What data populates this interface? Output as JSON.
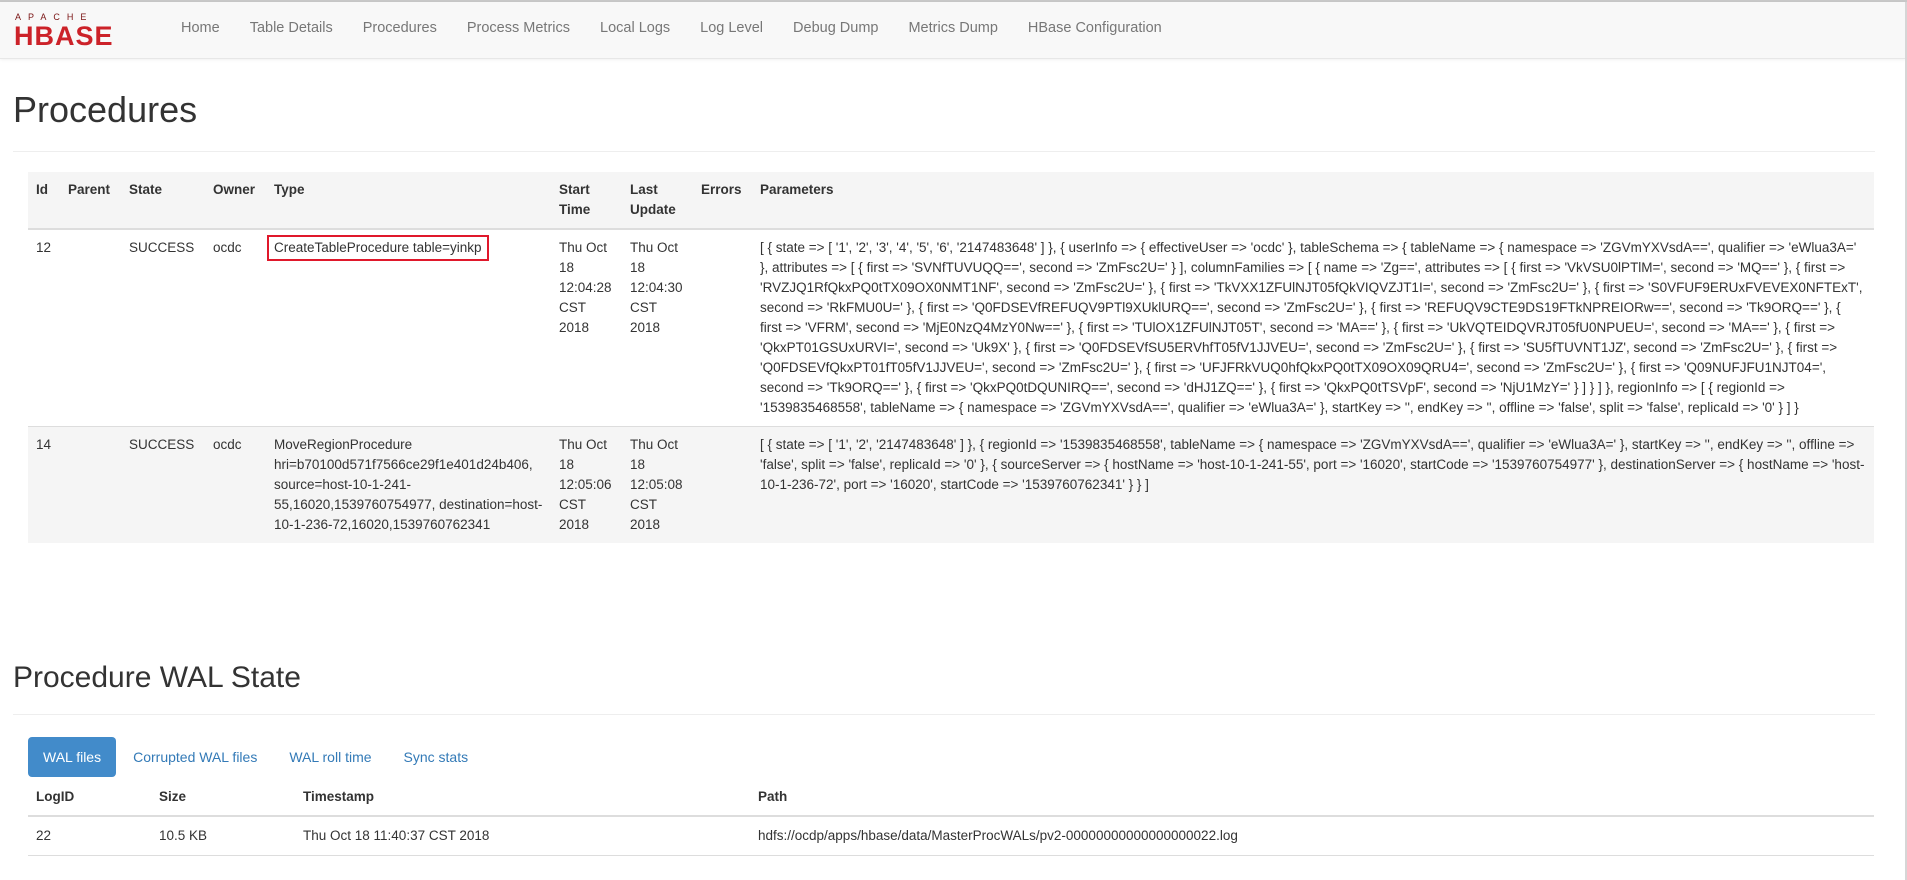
{
  "brand": {
    "top": "APACHE",
    "main": "HBASE",
    "color": "#cc2229"
  },
  "nav": {
    "items": [
      "Home",
      "Table Details",
      "Procedures",
      "Process Metrics",
      "Local Logs",
      "Log Level",
      "Debug Dump",
      "Metrics Dump",
      "HBase Configuration"
    ]
  },
  "procedures": {
    "title": "Procedures",
    "columns": [
      "Id",
      "Parent",
      "State",
      "Owner",
      "Type",
      "Start Time",
      "Last Update",
      "Errors",
      "Parameters"
    ],
    "rows": [
      {
        "id": "12",
        "parent": "",
        "state": "SUCCESS",
        "owner": "ocdc",
        "type": "CreateTableProcedure table=yinkp",
        "start_time": "Thu Oct 18 12:04:28 CST 2018",
        "last_update": "Thu Oct 18 12:04:30 CST 2018",
        "errors": "",
        "parameters": "[ { state => [ '1', '2', '3', '4', '5', '6', '2147483648' ] }, { userInfo => { effectiveUser => 'ocdc' }, tableSchema => { tableName => { namespace => 'ZGVmYXVsdA==', qualifier => 'eWlua3A=' }, attributes => [ { first => 'SVNfTUVUQQ==', second => 'ZmFsc2U=' } ], columnFamilies => [ { name => 'Zg==', attributes => [ { first => 'VkVSU0lPTlM=', second => 'MQ==' }, { first => 'RVZJQ1RfQkxPQ0tTX09OX0NMT1NF', second => 'ZmFsc2U=' }, { first => 'TkVXX1ZFUlNJT05fQkVIQVZJT1I=', second => 'ZmFsc2U=' }, { first => 'S0VFUF9ERUxFVEVEX0NFTExT', second => 'RkFMU0U=' }, { first => 'Q0FDSEVfREFUQV9PTl9XUklURQ==', second => 'ZmFsc2U=' }, { first => 'REFUQV9CTE9DS19FTkNPREIORw==', second => 'Tk9ORQ==' }, { first => 'VFRM', second => 'MjE0NzQ4MzY0Nw==' }, { first => 'TUlOX1ZFUlNJT05T', second => 'MA==' }, { first => 'UkVQTEIDQVRJT05fU0NPUEU=', second => 'MA==' }, { first => 'QkxPT01GSUxURVI=', second => 'Uk9X' }, { first => 'Q0FDSEVfSU5ERVhfT05fV1JJVEU=', second => 'ZmFsc2U=' }, { first => 'SU5fTUVNT1JZ', second => 'ZmFsc2U=' }, { first => 'Q0FDSEVfQkxPT01fT05fV1JJVEU=', second => 'ZmFsc2U=' }, { first => 'UFJFRkVUQ0hfQkxPQ0tTX09OX09QRU4=', second => 'ZmFsc2U=' }, { first => 'Q09NUFJFU1NJT04=', second => 'Tk9ORQ==' }, { first => 'QkxPQ0tDQUNIRQ==', second => 'dHJ1ZQ==' }, { first => 'QkxPQ0tTSVpF', second => 'NjU1MzY=' } ] } ] }, regionInfo => [ { regionId => '1539835468558', tableName => { namespace => 'ZGVmYXVsdA==', qualifier => 'eWlua3A=' }, startKey => '', endKey => '', offline => 'false', split => 'false', replicaId => '0' } ] }"
      },
      {
        "id": "14",
        "parent": "",
        "state": "SUCCESS",
        "owner": "ocdc",
        "type": "MoveRegionProcedure hri=b70100d571f7566ce29f1e401d24b406, source=host-10-1-241-55,16020,1539760754977, destination=host-10-1-236-72,16020,1539760762341",
        "start_time": "Thu Oct 18 12:05:06 CST 2018",
        "last_update": "Thu Oct 18 12:05:08 CST 2018",
        "errors": "",
        "parameters": "[ { state => [ '1', '2', '2147483648' ] }, { regionId => '1539835468558', tableName => { namespace => 'ZGVmYXVsdA==', qualifier => 'eWlua3A=' }, startKey => '', endKey => '', offline => 'false', split => 'false', replicaId => '0' }, { sourceServer => { hostName => 'host-10-1-241-55', port => '16020', startCode => '1539760754977' }, destinationServer => { hostName => 'host-10-1-236-72', port => '16020', startCode => '1539760762341' } } ]"
      }
    ]
  },
  "wal": {
    "title": "Procedure WAL State",
    "tabs": [
      "WAL files",
      "Corrupted WAL files",
      "WAL roll time",
      "Sync stats"
    ],
    "active_tab": "WAL files",
    "columns": [
      "LogID",
      "Size",
      "Timestamp",
      "Path"
    ],
    "rows": [
      {
        "logid": "22",
        "size": "10.5 KB",
        "timestamp": "Thu Oct 18 11:40:37 CST 2018",
        "path": "hdfs://ocdp/apps/hbase/data/MasterProcWALs/pv2-00000000000000000022.log"
      }
    ]
  },
  "colors": {
    "accent": "#428bca",
    "link": "#337ab7",
    "highlight_box": "#e0182b"
  }
}
